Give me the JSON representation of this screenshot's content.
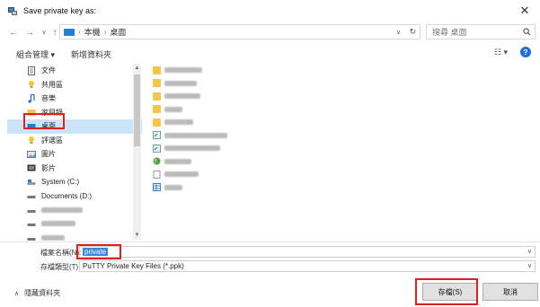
{
  "window": {
    "title": "Save private key as:",
    "close_glyph": "✕"
  },
  "address": {
    "breadcrumb": [
      "本機",
      "桌面"
    ],
    "search_placeholder": "搜尋 桌面"
  },
  "toolbar": {
    "organize_label": "組合管理 ▾",
    "new_folder_label": "新增資料夾",
    "view_label": "☷ ▾"
  },
  "nav": {
    "items": [
      {
        "label": "文件",
        "icon": "document-icon"
      },
      {
        "label": "共用區",
        "icon": "lightbulb-icon"
      },
      {
        "label": "音樂",
        "icon": "music-icon"
      },
      {
        "label": "家目錄",
        "icon": "folder-icon"
      },
      {
        "label": "桌面",
        "icon": "desktop-icon"
      },
      {
        "label": "評選區",
        "icon": "lightbulb-icon"
      },
      {
        "label": "圖片",
        "icon": "picture-icon"
      },
      {
        "label": "影片",
        "icon": "video-icon"
      },
      {
        "label": "System (C:)",
        "icon": "drive-icon"
      },
      {
        "label": "Documents (D:)",
        "icon": "drive-icon"
      }
    ]
  },
  "fields": {
    "filename_label": "檔案名稱(N):",
    "filename_value": "private",
    "filetype_label": "存檔類型(T):",
    "filetype_value": "PuTTY Private Key Files (*.ppk)"
  },
  "footer": {
    "hide_folders_label": "隱藏資料夾",
    "save_label": "存檔(S)",
    "cancel_label": "取消"
  },
  "colors": {
    "highlight": "#e0201f",
    "selection": "#cce4f7",
    "accent": "#1f6fd6"
  }
}
